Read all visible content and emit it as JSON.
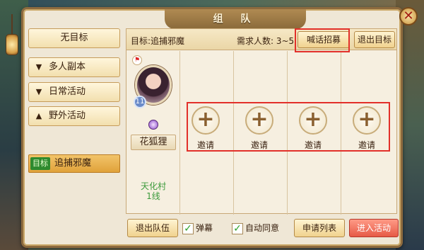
{
  "window": {
    "title": "组 队",
    "close_icon": "close-icon"
  },
  "sidebar": {
    "no_target": "无目标",
    "groups": [
      {
        "label": "多人副本",
        "expanded": false
      },
      {
        "label": "日常活动",
        "expanded": false
      },
      {
        "label": "野外活动",
        "expanded": true
      }
    ],
    "selected_sub": {
      "tag": "目标",
      "label": "追捕邪魔"
    }
  },
  "topbar": {
    "target": "目标:追捕邪魔",
    "required": "需求人数: 3~5",
    "shout_button": "喊话招募",
    "leave_target_button": "退出目标"
  },
  "member": {
    "level": "11",
    "name": "花狐狸",
    "map": "天化村",
    "line": "1线"
  },
  "slots": [
    {
      "label": "邀请"
    },
    {
      "label": "邀请"
    },
    {
      "label": "邀请"
    },
    {
      "label": "邀请"
    }
  ],
  "bottom": {
    "leave_team": "退出队伍",
    "barrage": {
      "label": "弹幕",
      "checked": true
    },
    "auto_accept": {
      "label": "自动同意",
      "checked": true
    },
    "apply_list": "申请列表",
    "enter_activity": "进入活动"
  },
  "colors": {
    "highlight": "#e2302a",
    "accent": "#e65a46",
    "green": "#3b9a3b"
  }
}
